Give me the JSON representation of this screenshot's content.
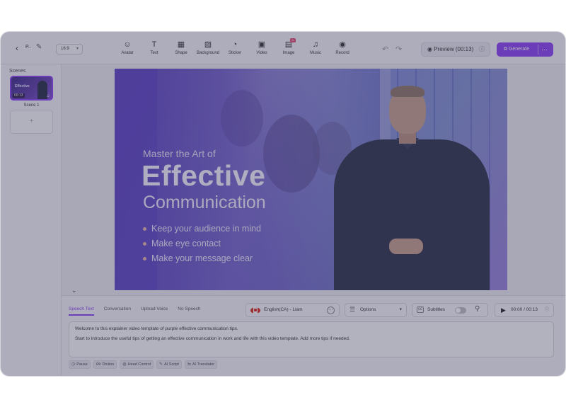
{
  "toolbar": {
    "project_name": "P..",
    "aspect_ratio": "16:9",
    "tools": [
      {
        "label": "Avatar",
        "icon": "☺",
        "name": "tool-avatar"
      },
      {
        "label": "Text",
        "icon": "T",
        "name": "tool-text"
      },
      {
        "label": "Shape",
        "icon": "▦",
        "name": "tool-shape"
      },
      {
        "label": "Background",
        "icon": "▨",
        "name": "tool-background"
      },
      {
        "label": "Sticker",
        "icon": "◔",
        "name": "tool-sticker"
      },
      {
        "label": "Video",
        "icon": "▣",
        "name": "tool-video"
      },
      {
        "label": "Image",
        "icon": "▤",
        "name": "tool-image",
        "badge": "AI"
      },
      {
        "label": "Music",
        "icon": "♫",
        "name": "tool-music"
      },
      {
        "label": "Record",
        "icon": "◉",
        "name": "tool-record"
      }
    ],
    "preview_label": "Preview (00:13)",
    "generate_label": "Generate",
    "more_label": "⋯"
  },
  "scenes": {
    "title": "Scenes",
    "items": [
      {
        "label": "Scene 1",
        "duration": "00:13",
        "thumb_title": "Effective"
      }
    ],
    "add_icon": "+"
  },
  "video": {
    "subtitle": "Master the Art of",
    "title": "Effective",
    "title2": "Communication",
    "bullets": [
      "Keep your audience in mind",
      "Make eye contact",
      "Make your message clear"
    ]
  },
  "editor": {
    "tabs": [
      {
        "label": "Speech Text",
        "active": true
      },
      {
        "label": "Conversation",
        "active": false
      },
      {
        "label": "Upload Voice",
        "active": false
      },
      {
        "label": "No Speech",
        "active": false
      }
    ],
    "voice": "English(CA) - Liam",
    "options_label": "Options",
    "subtitles_label": "Subtitles",
    "subtitles_on": false,
    "time": "00:00 / 00:13",
    "script_lines": [
      "Welcome to this explainer video template of purple effective communication tips.",
      "Start to introduce the useful tips of getting an effective communication in work and life with this video template. Add more tips if needed."
    ],
    "chips": [
      {
        "icon": "◷",
        "label": "Pause"
      },
      {
        "icon": "de",
        "label": "Diction"
      },
      {
        "icon": "◍",
        "label": "Head Control"
      },
      {
        "icon": "✎",
        "label": "AI Script"
      },
      {
        "icon": "⇆",
        "label": "AI Translator"
      }
    ]
  },
  "colors": {
    "accent": "#8a3ff2",
    "slide_bg": "#5c3fc0",
    "presenter_shirt": "#2a3148"
  }
}
